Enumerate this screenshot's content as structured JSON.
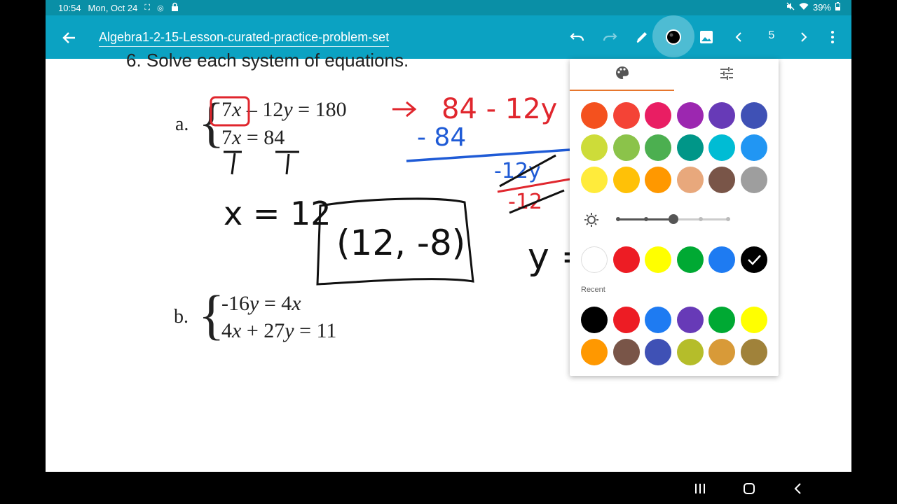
{
  "status": {
    "time": "10:54",
    "date": "Mon, Oct 24",
    "battery": "39%"
  },
  "appbar": {
    "title": "Algebra1-2-15-Lesson-curated-practice-problem-set",
    "page": "5"
  },
  "document": {
    "heading": "6. Solve each system of equations.",
    "part_a": {
      "label": "a.",
      "eq1_a": "7",
      "eq1_b": "x",
      "eq1_c": "– 12",
      "eq1_d": "y",
      "eq1_e": "= 180",
      "eq2_a": "7",
      "eq2_b": "x",
      "eq2_c": "= 84"
    },
    "part_b": {
      "label": "b.",
      "eq1_a": "-16",
      "eq1_b": "y",
      "eq1_c": "= 4",
      "eq1_d": "x",
      "eq2_a": "4",
      "eq2_b": "x",
      "eq2_c": "+ 27",
      "eq2_d": "y",
      "eq2_e": "= 11"
    }
  },
  "color_panel": {
    "tabs": [
      "palette-icon",
      "tune-icon"
    ],
    "palette": [
      "#f4511e",
      "#f44336",
      "#e91e63",
      "#9c27b0",
      "#673ab7",
      "#3f51b5",
      "#cddc39",
      "#8bc34a",
      "#4caf50",
      "#009688",
      "#00bcd4",
      "#2196f3",
      "#ffeb3b",
      "#ffc107",
      "#ff9800",
      "#e8a87c",
      "#795548",
      "#9e9e9e"
    ],
    "basic": [
      "#ffffff",
      "#ed1c24",
      "#ffff00",
      "#00a933",
      "#1e7bf2",
      "#000000"
    ],
    "selected": "#000000",
    "recent_label": "Recent",
    "recent": [
      "#000000",
      "#ed1c24",
      "#1e7bf2",
      "#673ab7",
      "#00a933",
      "#ffff00",
      "#ff9800",
      "#795548",
      "#3f51b5",
      "#b5bd2a",
      "#d89a38",
      "#a0823a"
    ]
  }
}
